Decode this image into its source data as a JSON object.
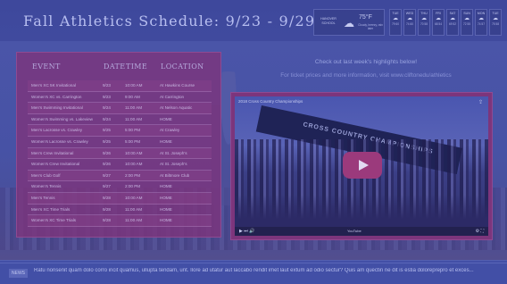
{
  "header": {
    "title": "Fall Athletics Schedule: 9/23 - 9/29"
  },
  "weather": {
    "location": "HANOVER SCHOOL",
    "icon": "cloud-rain-icon",
    "temperature": "75°F",
    "description": "Cloudy, breezy, rain later"
  },
  "forecast": [
    {
      "day": "TUE",
      "icon": "cloud-icon",
      "temps": "79 60"
    },
    {
      "day": "WED",
      "icon": "cloud-icon",
      "temps": "74 60"
    },
    {
      "day": "THU",
      "icon": "cloud-icon",
      "temps": "70 58"
    },
    {
      "day": "FRI",
      "icon": "cloud-icon",
      "temps": "68 54"
    },
    {
      "day": "SAT",
      "icon": "cloud-icon",
      "temps": "69 52"
    },
    {
      "day": "SUN",
      "icon": "cloud-icon",
      "temps": "72 55"
    },
    {
      "day": "MON",
      "icon": "cloud-icon",
      "temps": "74 57"
    },
    {
      "day": "TUE",
      "icon": "cloud-icon",
      "temps": "75 58"
    }
  ],
  "schedule": {
    "headers": {
      "event": "EVENT",
      "date": "DATE",
      "time": "TIME",
      "location": "LOCATION"
    },
    "rows": [
      {
        "event": "Men's XC 5K Invitational",
        "date": "9/23",
        "time": "10:00 AM",
        "location": "At Hawkins Course"
      },
      {
        "event": "Women's XC vs. Carrington",
        "date": "9/23",
        "time": "9:00 AM",
        "location": "At Carrington"
      },
      {
        "event": "Men's Swimming Invitational",
        "date": "9/24",
        "time": "11:00 AM",
        "location": "At Nelson Aquatic"
      },
      {
        "event": "Women's Swimming vs. Lakeview",
        "date": "9/24",
        "time": "11:00 AM",
        "location": "HOME"
      },
      {
        "event": "Men's Lacrosse vs. Crawley",
        "date": "9/25",
        "time": "5:00 PM",
        "location": "At Crawley"
      },
      {
        "event": "Women's Lacrosse vs. Crawley",
        "date": "9/25",
        "time": "5:00 PM",
        "location": "HOME"
      },
      {
        "event": "Men's Crew Invitational",
        "date": "9/26",
        "time": "10:00 AM",
        "location": "At St. Joseph's"
      },
      {
        "event": "Women's Crew Invitational",
        "date": "9/26",
        "time": "10:00 AM",
        "location": "At St. Joseph's"
      },
      {
        "event": "Men's Club Golf",
        "date": "9/27",
        "time": "2:00 PM",
        "location": "At Biltmore Club"
      },
      {
        "event": "Women's Tennis",
        "date": "9/27",
        "time": "2:00 PM",
        "location": "HOME"
      },
      {
        "event": "Men's Tennis",
        "date": "9/28",
        "time": "10:00 AM",
        "location": "HOME"
      },
      {
        "event": "Men's XC Time Trials",
        "date": "9/28",
        "time": "11:00 AM",
        "location": "HOME"
      },
      {
        "event": "Women's XC Time Trials",
        "date": "9/28",
        "time": "11:00 AM",
        "location": "HOME"
      }
    ]
  },
  "promo": {
    "line1": "Check out last week's highlights below!",
    "line2": "For ticket prices and more information, visit www.cliftonedu/athletics"
  },
  "video": {
    "top_label": "2018 Cross Country Championships",
    "banner_text": "CROSS COUNTRY CHAMPIONSHIPS",
    "share_icon": "share-icon",
    "brand": "YouTube"
  },
  "ticker": {
    "label": "NEWS",
    "text": "Ratu nonsenit quam dolo corro incit quamus, ullupta tendam, unt. Ilore ad utatur aut laccabo rendit imet laut extum ad odio sectur? Quis am quectin ne dit is estia doloreprepro et exces..."
  }
}
